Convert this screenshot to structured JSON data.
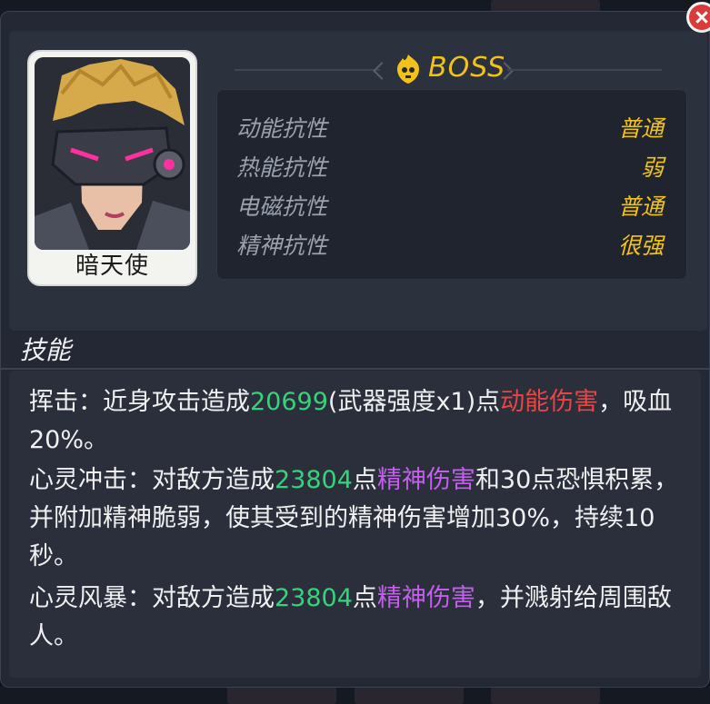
{
  "boss": {
    "character_name": "暗天使",
    "badge": "BOSS",
    "icon": "boss-skull-flame-icon"
  },
  "resistances": [
    {
      "name": "动能抗性",
      "value": "普通"
    },
    {
      "name": "热能抗性",
      "value": "弱"
    },
    {
      "name": "电磁抗性",
      "value": "普通"
    },
    {
      "name": "精神抗性",
      "value": "很强"
    }
  ],
  "skills": {
    "title": "技能",
    "items": [
      {
        "name_prefix": "挥击：近身攻击造成",
        "value": "20699",
        "mid": "(武器强度x1)点",
        "damage_type": "动能伤害",
        "suffix": "，吸血20%。"
      },
      {
        "name_prefix": "心灵冲击：对敌方造成",
        "value": "23804",
        "mid": "点",
        "damage_type": "精神伤害",
        "suffix": "和30点恐惧积累，并附加精神脆弱，使其受到的精神伤害增加30%，持续10秒。"
      },
      {
        "name_prefix": "心灵风暴：对敌方造成",
        "value": "23804",
        "mid": "点",
        "damage_type": "精神伤害",
        "suffix": "，并溅射给周围敌人。"
      }
    ]
  },
  "colors": {
    "accent_gold": "#f2c21a",
    "value_green": "#37d37a",
    "kinetic_red": "#e84545",
    "psychic_purple": "#c260ea",
    "close_red": "#d93a3a"
  }
}
